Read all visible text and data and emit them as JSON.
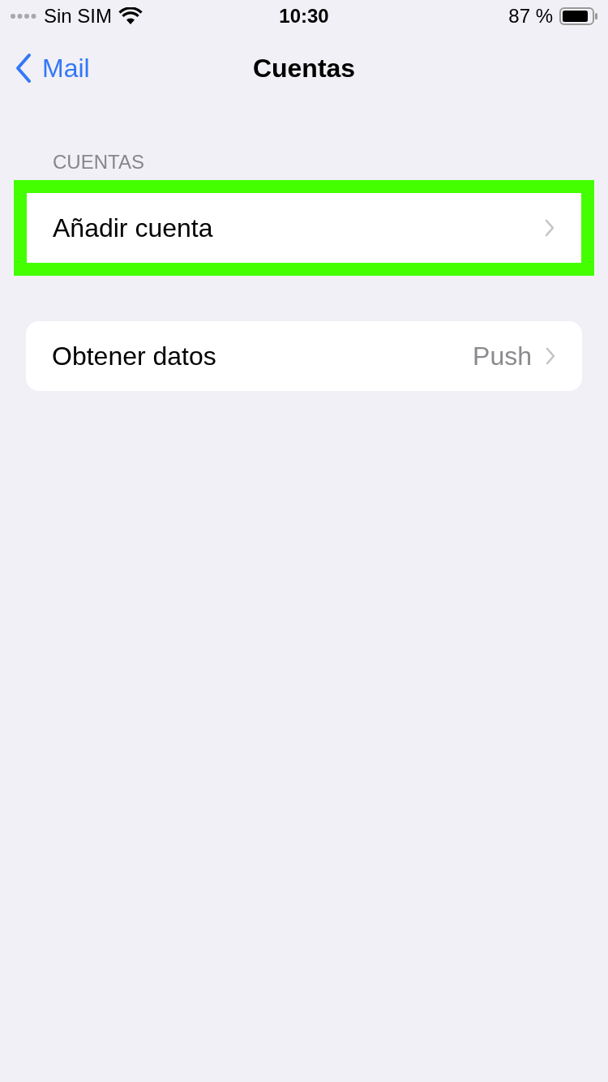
{
  "status_bar": {
    "carrier": "Sin SIM",
    "time": "10:30",
    "battery": "87 %"
  },
  "nav": {
    "back": "Mail",
    "title": "Cuentas"
  },
  "sections": [
    {
      "header": "CUENTAS",
      "rows": [
        {
          "label": "Añadir cuenta",
          "highlighted": true
        }
      ]
    },
    {
      "rows": [
        {
          "label": "Obtener datos",
          "value": "Push",
          "highlighted": false
        }
      ]
    }
  ]
}
